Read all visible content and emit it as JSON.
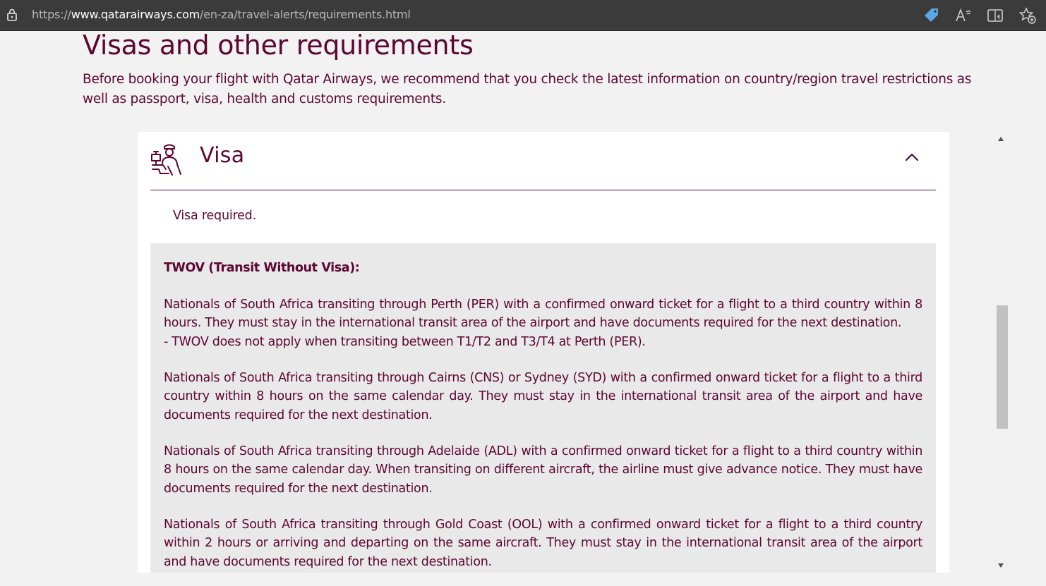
{
  "browser": {
    "url_scheme": "https://",
    "url_host": "www.qatarairways.com",
    "url_path": "/en-za/travel-alerts/requirements.html",
    "icons": [
      "lock-icon",
      "coupon-tag-icon",
      "read-aloud-icon",
      "immersive-reader-icon",
      "add-favorite-icon"
    ]
  },
  "page": {
    "title": "Visas and other requirements",
    "intro": "Before booking your flight with Qatar Airways, we recommend that you check the latest information on country/region travel restrictions as well as passport, visa, health and customs requirements."
  },
  "visa_section": {
    "icon": "visa-officer-icon",
    "title": "Visa",
    "expanded": true,
    "status": "Visa required.",
    "twov": {
      "heading": "TWOV (Transit Without Visa):",
      "paragraphs": [
        "Nationals of South Africa transiting through Perth (PER) with a confirmed onward ticket for a flight to a third country within 8 hours. They must stay in the international transit area of the airport and have documents required for the next destination.",
        "- TWOV does not apply when transiting between T1/T2 and T3/T4 at Perth (PER).",
        "Nationals of South Africa transiting through Cairns (CNS) or Sydney (SYD) with a confirmed onward ticket for a flight to a third country within 8 hours on the same calendar day. They must stay in the international transit area of the airport and have documents required for the next destination.",
        "Nationals of South Africa transiting through Adelaide (ADL) with a confirmed onward ticket for a flight to a third country within 8 hours on the same calendar day. When transiting on different aircraft, the airline must give advance notice. They must have documents required for the next destination.",
        "Nationals of South Africa transiting through Gold Coast (OOL) with a confirmed onward ticket for a flight to a third country within 2 hours or arriving and departing on the same aircraft. They must stay in the international transit area of the airport and have documents required for the next destination."
      ]
    }
  },
  "colors": {
    "brand": "#5c0632",
    "page_bg": "#f2f2f2",
    "info_box_bg": "#e9e9e9",
    "toolbar_bg": "#3b3b3b",
    "tag_icon": "#5aa7e6"
  }
}
